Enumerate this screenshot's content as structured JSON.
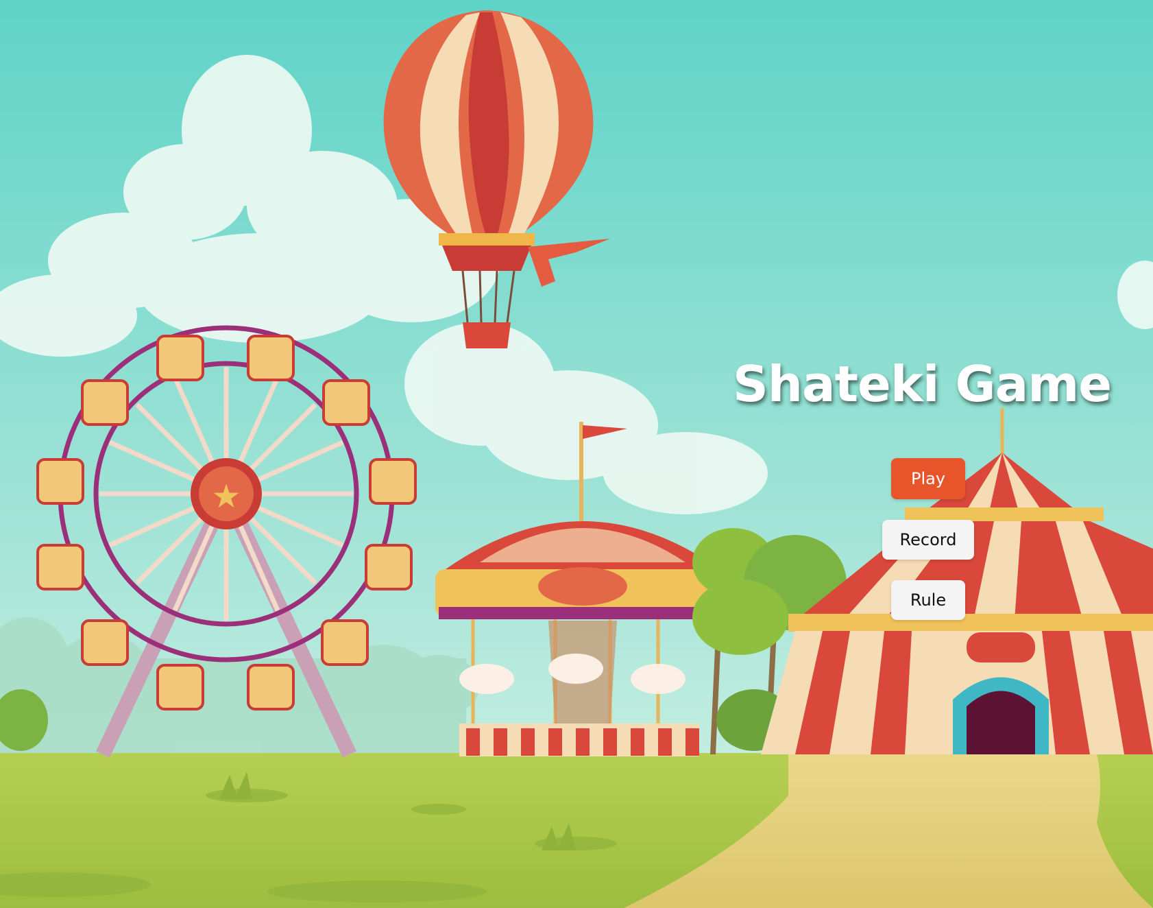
{
  "game": {
    "title": "Shateki Game",
    "buttons": {
      "play": "Play",
      "record": "Record",
      "rule": "Rule"
    },
    "colors": {
      "sky_top": "#5fd3c8",
      "sky_bottom": "#d6f3e6",
      "grass": "#a9c74a",
      "path": "#e4cf7b",
      "play_button": "#e8552b",
      "secondary_button": "#f4f4f4",
      "tent_red": "#d9483a",
      "tent_cream": "#f6dcb5"
    },
    "background": {
      "scene": "amusement park",
      "elements": [
        "hot-air-balloon",
        "ferris-wheel",
        "carousel",
        "circus-tent",
        "clouds",
        "trees",
        "grass-field",
        "dirt-path"
      ]
    }
  }
}
